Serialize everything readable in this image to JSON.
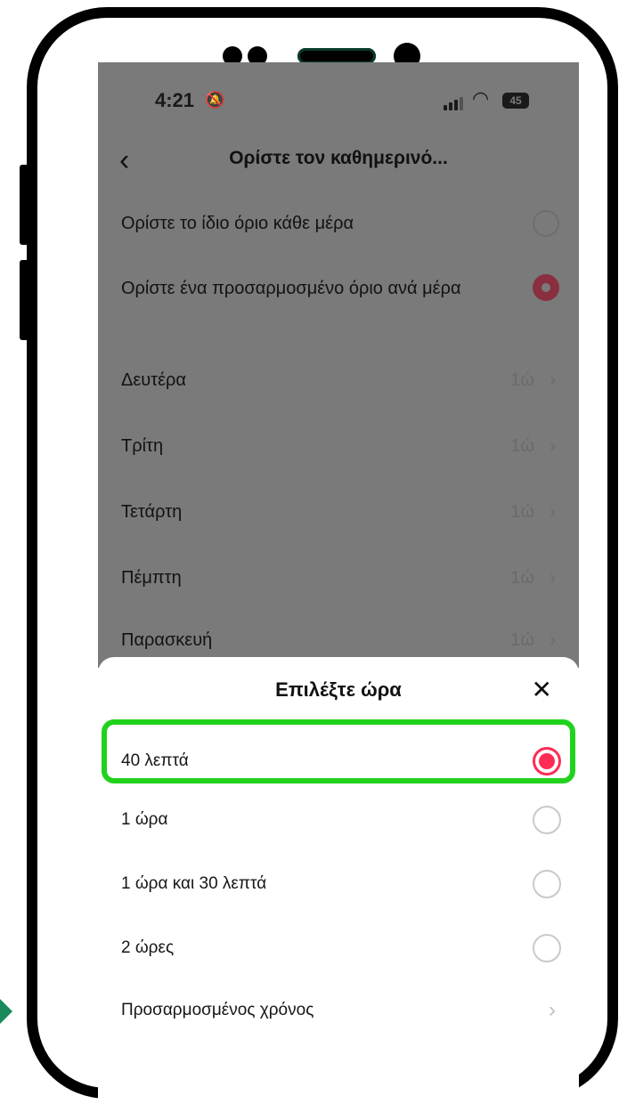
{
  "status_bar": {
    "time": "4:21",
    "battery": "45"
  },
  "nav": {
    "title": "Ορίστε τον καθημερινό..."
  },
  "options": {
    "same_limit_label": "Ορίστε το ίδιο όριο κάθε μέρα",
    "custom_limit_label": "Ορίστε ένα προσαρμοσμένο όριο ανά μέρα"
  },
  "days": [
    {
      "name": "Δευτέρα",
      "value": "1ώ"
    },
    {
      "name": "Τρίτη",
      "value": "1ώ"
    },
    {
      "name": "Τετάρτη",
      "value": "1ώ"
    },
    {
      "name": "Πέμπτη",
      "value": "1ώ"
    },
    {
      "name": "Παρασκευή",
      "value": "1ώ"
    }
  ],
  "sheet": {
    "title": "Επιλέξτε ώρα",
    "options": [
      {
        "label": "40 λεπτά",
        "selected": true
      },
      {
        "label": "1 ώρα",
        "selected": false
      },
      {
        "label": "1 ώρα και 30 λεπτά",
        "selected": false
      },
      {
        "label": "2 ώρες",
        "selected": false
      }
    ],
    "custom_label": "Προσαρμοσμένος χρόνος"
  },
  "colors": {
    "accent": "#fe2c55",
    "highlight": "#21d21d",
    "overlay": "#7a7a7a"
  }
}
